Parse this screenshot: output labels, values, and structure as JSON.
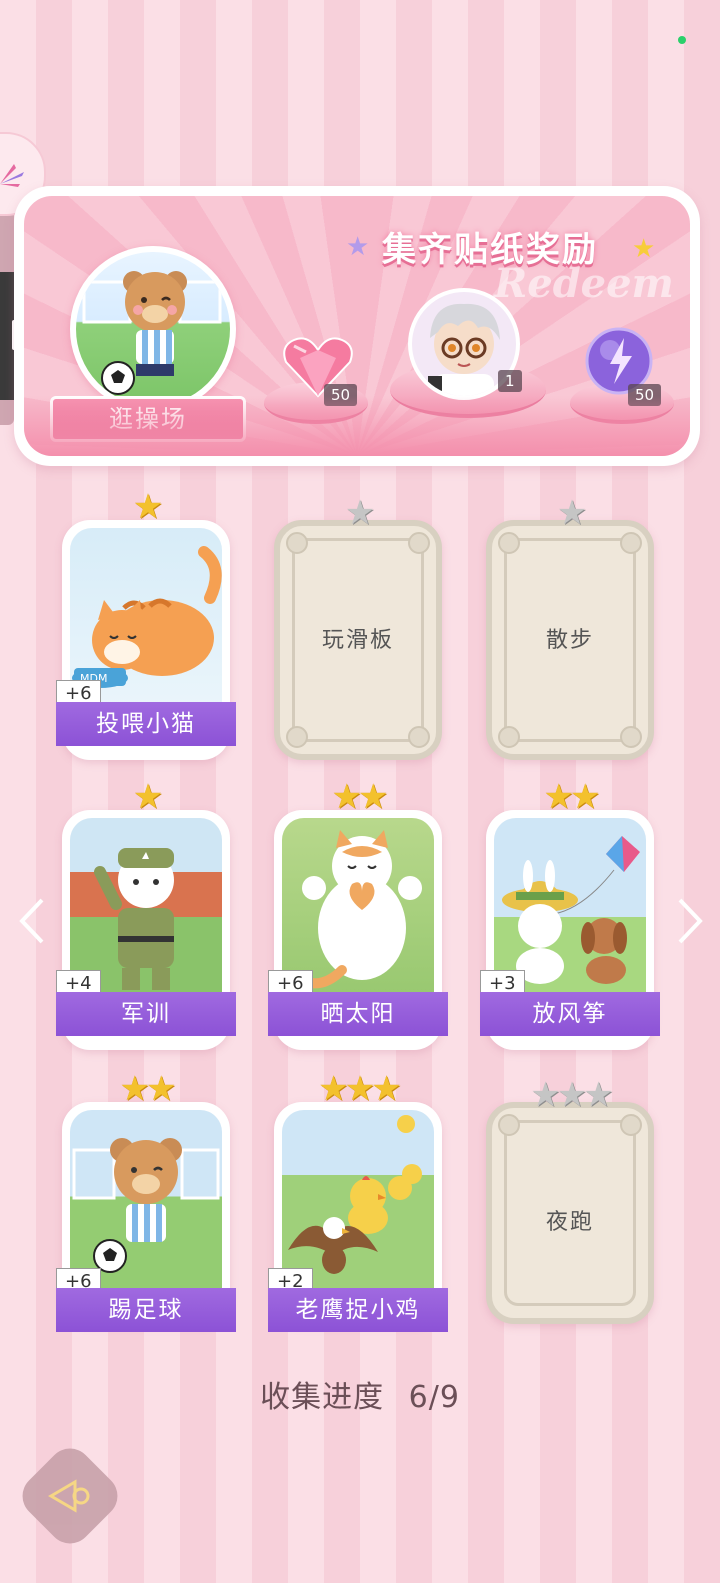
{
  "header": {
    "banner_title": "集齐贴纸奖励",
    "watermark": "Redeem",
    "location_label": "逛操场"
  },
  "rewards": [
    {
      "icon": "pink-heart-gem-icon",
      "count": "50"
    },
    {
      "icon": "character-avatar-icon",
      "count": "1"
    },
    {
      "icon": "purple-energy-orb-icon",
      "count": "50"
    }
  ],
  "cards": [
    {
      "name": "投喂小猫",
      "bonus": "+6",
      "stars_earned": 1,
      "stars_total": 1,
      "unlocked": true
    },
    {
      "name": "玩滑板",
      "bonus": "",
      "stars_earned": 0,
      "stars_total": 1,
      "unlocked": false
    },
    {
      "name": "散步",
      "bonus": "",
      "stars_earned": 0,
      "stars_total": 1,
      "unlocked": false
    },
    {
      "name": "军训",
      "bonus": "+4",
      "stars_earned": 1,
      "stars_total": 1,
      "unlocked": true
    },
    {
      "name": "晒太阳",
      "bonus": "+6",
      "stars_earned": 2,
      "stars_total": 2,
      "unlocked": true
    },
    {
      "name": "放风筝",
      "bonus": "+3",
      "stars_earned": 2,
      "stars_total": 2,
      "unlocked": true
    },
    {
      "name": "踢足球",
      "bonus": "+6",
      "stars_earned": 2,
      "stars_total": 2,
      "unlocked": true
    },
    {
      "name": "老鹰捉小鸡",
      "bonus": "+2",
      "stars_earned": 3,
      "stars_total": 3,
      "unlocked": true
    },
    {
      "name": "夜跑",
      "bonus": "",
      "stars_earned": 0,
      "stars_total": 3,
      "unlocked": false
    }
  ],
  "progress": {
    "label": "收集进度",
    "value": "6/9"
  },
  "colors": {
    "accent_purple": "#8c52d6",
    "accent_pink": "#e86d95",
    "star_gold": "#f3c12d"
  }
}
